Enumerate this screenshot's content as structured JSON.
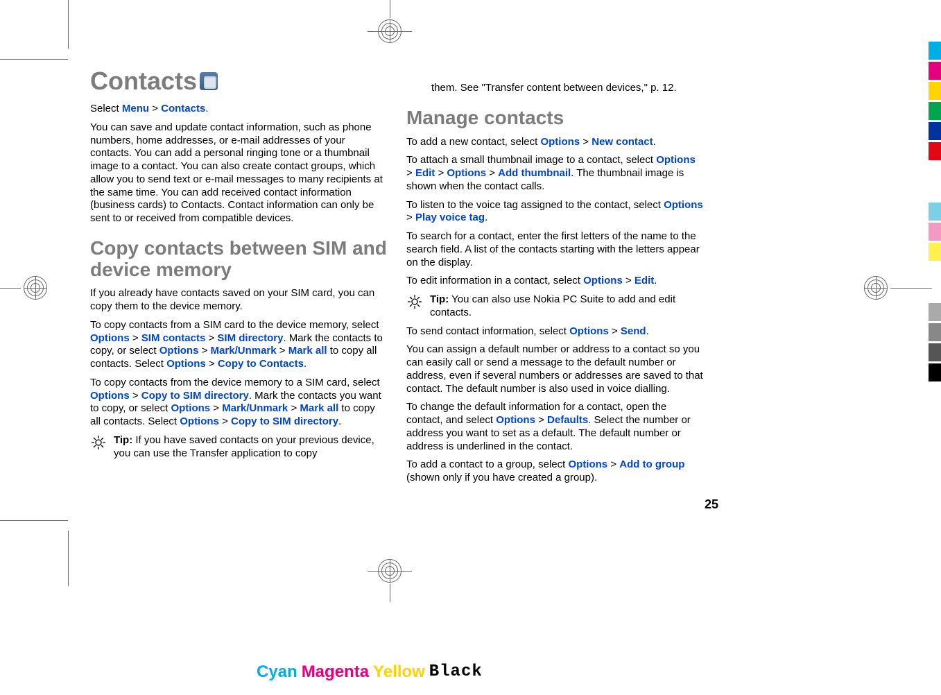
{
  "title": "Contacts",
  "pageNumber": "25",
  "col1": {
    "p1_a": "Select ",
    "p1_menu": "Menu",
    "p1_gt": " > ",
    "p1_contacts": "Contacts",
    "p1_end": ".",
    "p2": "You can save and update contact information, such as phone numbers, home addresses, or e-mail addresses of your contacts. You can add a personal ringing tone or a thumbnail image to a contact. You can also create contact groups, which allow you to send text or e-mail messages to many recipients at the same time. You can add received contact information (business cards) to Contacts. Contact information can only be sent to or received from compatible devices.",
    "h2": "Copy contacts between SIM and device memory",
    "p3": "If you already have contacts saved on your SIM card, you can copy them to the device memory.",
    "p4_a": "To copy contacts from a SIM card to the device memory, select ",
    "p4_options": "Options",
    "p4_gt1": " > ",
    "p4_sim_contacts": "SIM contacts",
    "p4_gt2": " > ",
    "p4_sim_dir": "SIM directory",
    "p4_b": ". Mark the contacts to copy, or select ",
    "p4_options2": "Options",
    "p4_gt3": " > ",
    "p4_mark_unmark": "Mark/Unmark",
    "p4_gt4": " > ",
    "p4_mark_all": "Mark all",
    "p4_c": " to copy all contacts. Select ",
    "p4_options3": "Options",
    "p4_gt5": " > ",
    "p4_copy_to_contacts": "Copy to Contacts",
    "p4_end": ".",
    "p5_a": "To copy contacts from the device memory to a SIM card, select ",
    "p5_options": "Options",
    "p5_gt1": " > ",
    "p5_copy_to_sim": "Copy to SIM directory",
    "p5_b": ". Mark the contacts you want to copy, or select ",
    "p5_options2": "Options",
    "p5_gt2": " > ",
    "p5_mark_unmark": "Mark/Unmark",
    "p5_gt3": " > ",
    "p5_mark_all": "Mark all",
    "p5_c": " to copy all contacts. Select ",
    "p5_options3": "Options",
    "p5_gt4": " > ",
    "p5_copy_to_sim2": "Copy to SIM directory",
    "p5_end": ".",
    "tip_label": "Tip:",
    "tip_text": " If you have saved contacts on your previous device, you can use the Transfer application to copy"
  },
  "col2": {
    "p1": "them. See \"Transfer content between devices,\" p. 12.",
    "h2": "Manage contacts",
    "p2_a": "To add a new contact, select ",
    "p2_options": "Options",
    "p2_gt": " > ",
    "p2_new_contact": "New contact",
    "p2_end": ".",
    "p3_a": "To attach a small thumbnail image to a contact, select ",
    "p3_options": "Options",
    "p3_gt1": " > ",
    "p3_edit": "Edit",
    "p3_gt2": " > ",
    "p3_options2": "Options",
    "p3_gt3": " > ",
    "p3_add_thumb": "Add thumbnail",
    "p3_b": ". The thumbnail image is shown when the contact calls.",
    "p4_a": "To listen to the voice tag assigned to the contact, select ",
    "p4_options": "Options",
    "p4_gt": " > ",
    "p4_play": "Play voice tag",
    "p4_end": ".",
    "p5": "To search for a contact, enter the first letters of the name to the search field. A list of the contacts starting with the letters appear on the display.",
    "p6_a": "To edit information in a contact, select ",
    "p6_options": "Options",
    "p6_gt": " > ",
    "p6_edit": "Edit",
    "p6_end": ".",
    "tip_label": "Tip:",
    "tip_text": " You can also use Nokia PC Suite to add and edit contacts.",
    "p7_a": "To send contact information, select ",
    "p7_options": "Options",
    "p7_gt": " > ",
    "p7_send": "Send",
    "p7_end": ".",
    "p8": "You can assign a default number or address to a contact so you can easily call or send a message to the default number or address, even if several numbers or addresses are saved to that contact. The default number is also used in voice dialling.",
    "p9_a": "To change the default information for a contact, open the contact, and select ",
    "p9_options": "Options",
    "p9_gt": " > ",
    "p9_defaults": "Defaults",
    "p9_b": ". Select the number or address you want to set as a default. The default number or address is underlined in the contact.",
    "p10_a": "To add a contact to a group, select ",
    "p10_options": "Options",
    "p10_gt": " > ",
    "p10_add_to_group": "Add to group",
    "p10_b": " (shown only if you have created a group)."
  },
  "cmyk": {
    "c": "Cyan",
    "m": "Magenta",
    "y": "Yellow",
    "k": "Black"
  },
  "colorbars": [
    "#00aee6",
    "#e6007e",
    "#ffd400",
    "#00a64f",
    "#0033a0",
    "#e30613",
    "#ffffff",
    "#ffffff",
    "#7bd0e8",
    "#f29ac4",
    "#fff04d",
    "#ffffff",
    "#ffffff",
    "#aaaaaa",
    "#888888",
    "#555555",
    "#000000"
  ]
}
